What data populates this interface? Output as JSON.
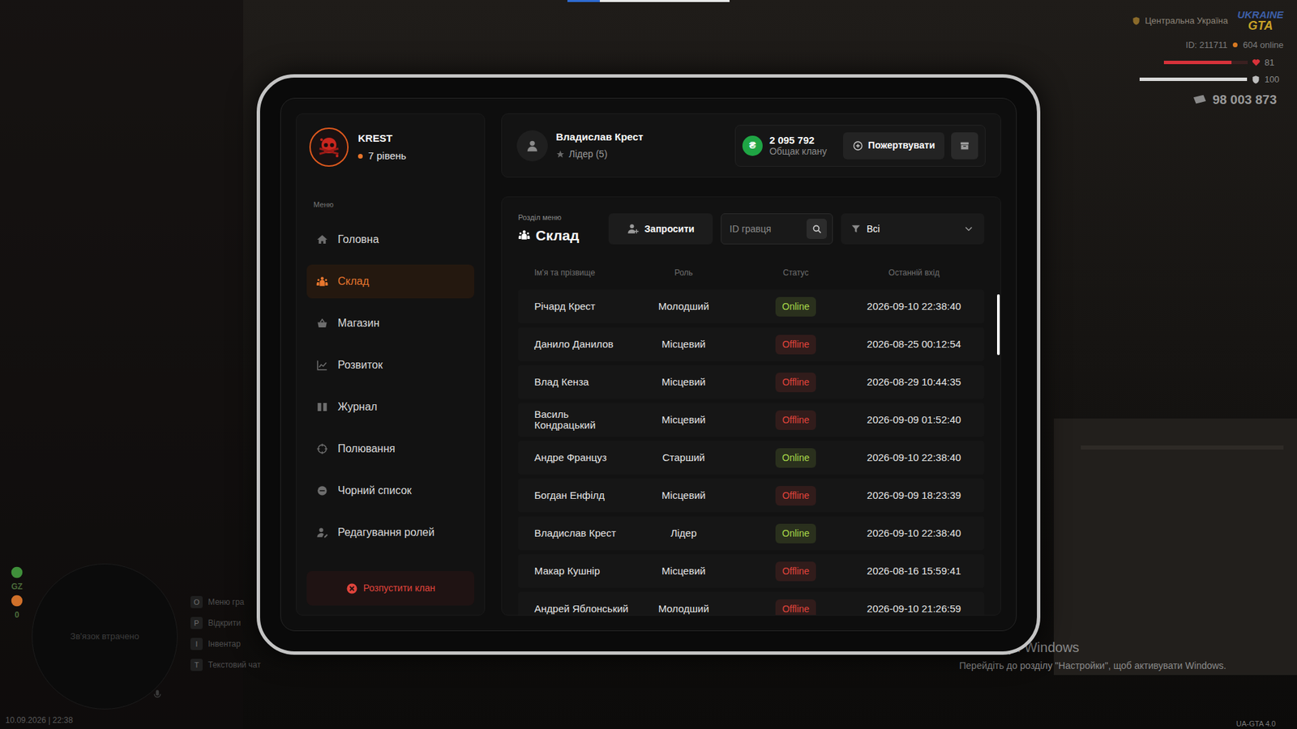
{
  "top_loader": {
    "level": 0.2
  },
  "hud": {
    "region": "Центральна Україна",
    "logo": [
      "UKRAINE",
      "GTA"
    ],
    "player_id": "ID: 211711",
    "online": "604 online",
    "health": {
      "value": "81",
      "level": 0.81
    },
    "armor": {
      "value": "100",
      "level": 1
    },
    "money": "98 003 873",
    "side_stats": [
      {
        "label": "GZ",
        "color": "#3f8f3a"
      },
      {
        "label": "0",
        "color": "#d0702a"
      }
    ],
    "minimap": "Зв'язок втрачено",
    "hints": [
      {
        "key": "O",
        "label": "Меню гра"
      },
      {
        "key": "P",
        "label": "Відкрити"
      },
      {
        "key": "I",
        "label": "Інвентар"
      },
      {
        "key": "T",
        "label": "Текстовий чат"
      }
    ],
    "date": "10.09.2026 | 22:38",
    "version": "UA-GTA 4.0"
  },
  "windows_notice": {
    "title": "Активація Windows",
    "text": "Перейдіть до розділу \"Настройки\", щоб активувати Windows."
  },
  "clan": {
    "name": "KREST",
    "level": "7 рівень"
  },
  "sidebar": {
    "label": "Меню",
    "items": [
      {
        "label": "Головна",
        "selected": false
      },
      {
        "label": "Склад",
        "selected": true
      },
      {
        "label": "Магазин",
        "selected": false
      },
      {
        "label": "Розвиток",
        "selected": false
      },
      {
        "label": "Журнал",
        "selected": false
      },
      {
        "label": "Полювання",
        "selected": false
      },
      {
        "label": "Чорний список",
        "selected": false
      },
      {
        "label": "Редагування ролей",
        "selected": false
      }
    ],
    "disband": "Розпустити клан"
  },
  "user": {
    "name": "Владислав Крест",
    "role": "Лідер (5)"
  },
  "treasury": {
    "currency": "₴",
    "amount": "2 095 792",
    "label": "Общак клану",
    "donate": "Пожертвувати"
  },
  "section": {
    "caption": "Розділ меню",
    "title": "Склад"
  },
  "invite": "Запросити",
  "search": {
    "placeholder": "ID гравця"
  },
  "filter": {
    "value": "Всі"
  },
  "table": {
    "columns": [
      "Ім'я та прізвище",
      "Роль",
      "Статус",
      "Останній вхід"
    ],
    "rows": [
      {
        "name": "Річард Крест",
        "role": "Молодший",
        "status": "Online",
        "color": "#a9d94a",
        "last": "2026-09-10 22:38:40"
      },
      {
        "name": "Данило Данилов",
        "role": "Місцевий",
        "status": "Offline",
        "color": "#e0443c",
        "last": "2026-08-25 00:12:54"
      },
      {
        "name": "Влад Кенза",
        "role": "Місцевий",
        "status": "Offline",
        "color": "#e0443c",
        "last": "2026-08-29 10:44:35"
      },
      {
        "name": "Василь Кондрацький",
        "role": "Місцевий",
        "status": "Offline",
        "color": "#e0443c",
        "last": "2026-09-09 01:52:40"
      },
      {
        "name": "Андре Француз",
        "role": "Старший",
        "status": "Online",
        "color": "#a9d94a",
        "last": "2026-09-10 22:38:40"
      },
      {
        "name": "Богдан Енфілд",
        "role": "Місцевий",
        "status": "Offline",
        "color": "#e0443c",
        "last": "2026-09-09 18:23:39"
      },
      {
        "name": "Владислав Крест",
        "role": "Лідер",
        "status": "Online",
        "color": "#a9d94a",
        "last": "2026-09-10 22:38:40"
      },
      {
        "name": "Макар Кушнір",
        "role": "Місцевий",
        "status": "Offline",
        "color": "#e0443c",
        "last": "2026-08-16 15:59:41"
      },
      {
        "name": "Андрей Яблонський",
        "role": "Молодший",
        "status": "Offline",
        "color": "#e0443c",
        "last": "2026-09-10 21:26:59"
      }
    ]
  }
}
